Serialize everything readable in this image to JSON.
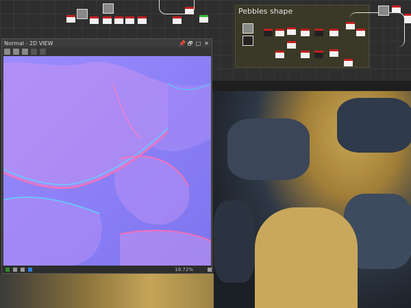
{
  "graph": {
    "frame_title": "Pebbles shape"
  },
  "window_2d": {
    "title": "Normal - 2D VIEW",
    "zoom": "18.72%",
    "controls": {
      "pin": "📌",
      "restore": "🗗",
      "maximize": "□",
      "close": "✕"
    }
  },
  "colors": {
    "node_header": "#c61f1f",
    "node_output": "#3bbd3b",
    "frame_bg": "#3a3826",
    "normal_base": "#8a7cf6"
  },
  "icons": [
    "settings-icon",
    "save-icon",
    "save-as-icon",
    "undo-icon",
    "redo-icon",
    "channel-icon",
    "histogram-icon",
    "info-icon",
    "fit-icon",
    "color-mode-icon"
  ]
}
